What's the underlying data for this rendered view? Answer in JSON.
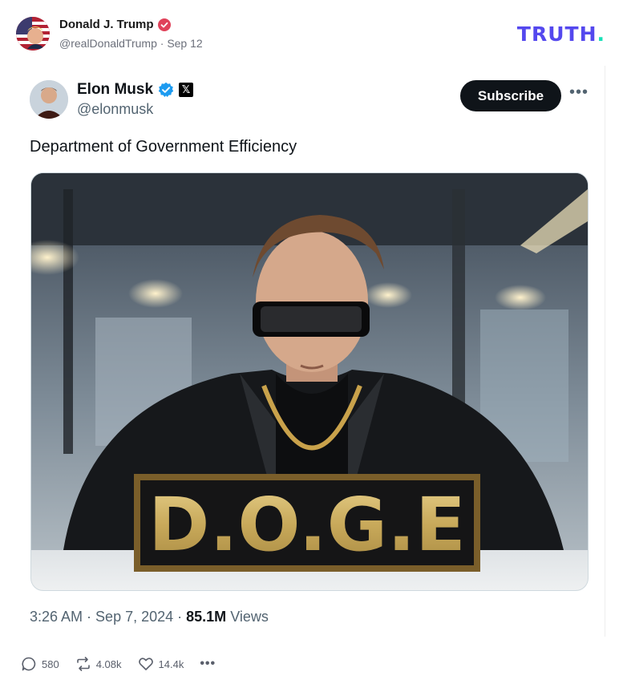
{
  "truth_post": {
    "author_name": "Donald J. Trump",
    "handle": "@realDonaldTrump",
    "date": "Sep 12",
    "meta_separator": " · ",
    "brand": {
      "logo_text": "TRUTH",
      "logo_dot": ".",
      "logo_color": "#5448ee",
      "dot_color": "#17e1b8"
    },
    "verified_color": "#e0425a"
  },
  "embedded_tweet": {
    "author_name": "Elon Musk",
    "handle": "@elonmusk",
    "verified_color": "#1d9bf0",
    "platform_icon": "x-logo-icon",
    "platform_letter": "𝕏",
    "subscribe_label": "Subscribe",
    "more_label": "•••",
    "text": "Department of Government Efficiency",
    "image_sign_text": "D.O.G.E",
    "time": "3:26 AM",
    "date": "Sep 7, 2024",
    "views_count": "85.1M",
    "views_label": "Views",
    "separator": " · "
  },
  "actions": {
    "replies": "580",
    "retruths": "4.08k",
    "likes": "14.4k",
    "more_label": "•••",
    "icons": [
      "comment-icon",
      "retruth-icon",
      "heart-icon",
      "more-icon"
    ]
  }
}
